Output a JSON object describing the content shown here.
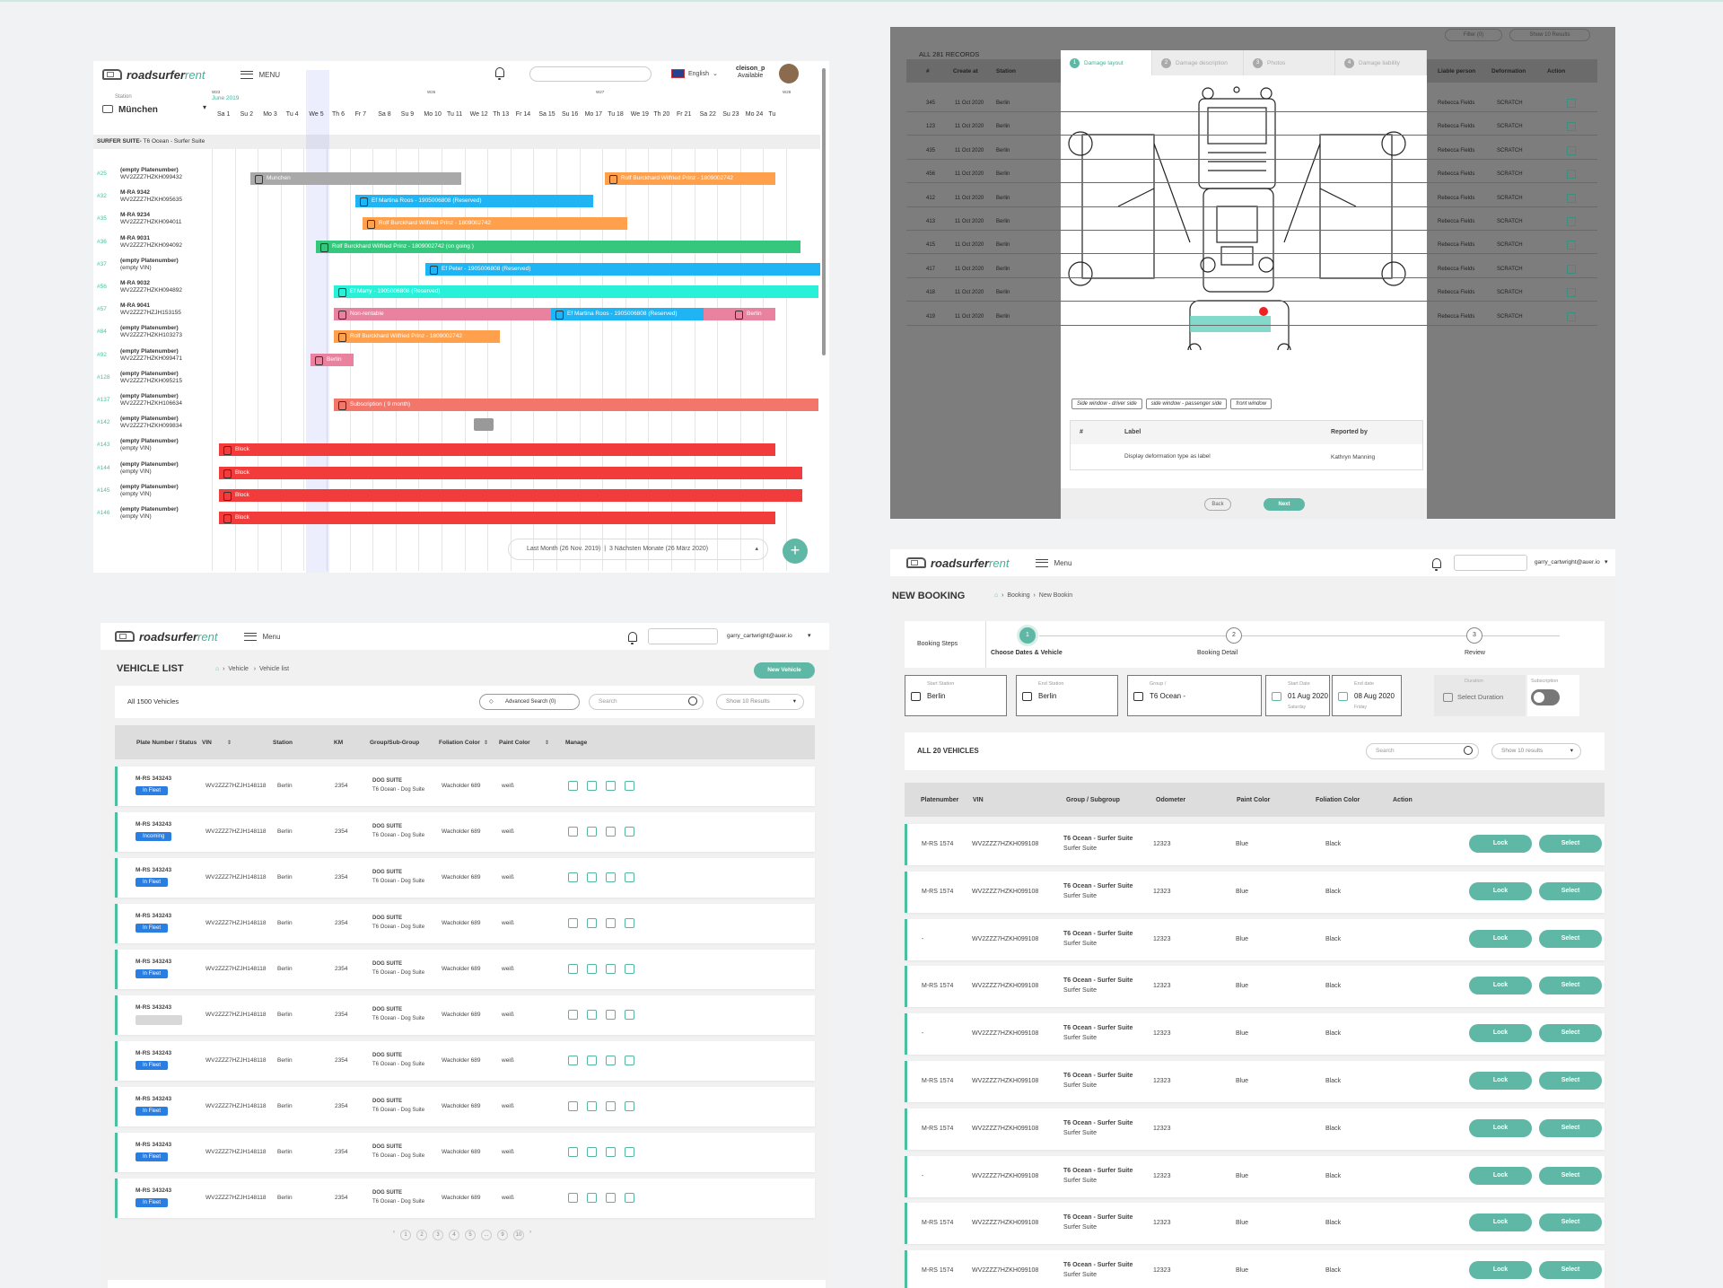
{
  "brand": {
    "name": "roadsurfer",
    "suffix": "rent"
  },
  "calendar": {
    "menu": "MENU",
    "language": "English",
    "user_name": "cleison_p",
    "user_status": "Available",
    "station_label": "Station",
    "station": "München",
    "month": "June 2019",
    "weeks": [
      "W23",
      "W26",
      "W27",
      "W28"
    ],
    "days": [
      "Sa 1",
      "Su 2",
      "Mo 3",
      "Tu 4",
      "We 5",
      "Th 6",
      "Fr 7",
      "Sa 8",
      "Su 9",
      "Mo 10",
      "Tu 11",
      "We 12",
      "Th 13",
      "Fr 14",
      "Sa 15",
      "Su 16",
      "Mo 17",
      "Tu 18",
      "We 19",
      "Th 20",
      "Fr 21",
      "Sa 22",
      "Su 23",
      "Mo 24",
      "Tu"
    ],
    "suite_title": "SURFER SUITE-",
    "suite_sub": "T6 Ocean - Surfer Suite",
    "vehicles": [
      {
        "num": "#25",
        "plate": "(empty Platenumber)",
        "vin": "WV2ZZZ7HZKH099432"
      },
      {
        "num": "#32",
        "plate": "M-RA 9342",
        "vin": "WV2ZZZ7HZKH095635"
      },
      {
        "num": "#35",
        "plate": "M-RA 9234",
        "vin": "WV2ZZZ7HZKH094011"
      },
      {
        "num": "#36",
        "plate": "M-RA 9031",
        "vin": "WV2ZZZ7HZKH094092"
      },
      {
        "num": "#37",
        "plate": "(empty Platenumber)",
        "vin": "(empty VIN)"
      },
      {
        "num": "#56",
        "plate": "M-RA 9032",
        "vin": "WV2ZZZ7HZKH094892"
      },
      {
        "num": "#57",
        "plate": "M-RA 9041",
        "vin": "WV2ZZZ7HZJH153155"
      },
      {
        "num": "#84",
        "plate": "(empty Platenumber)",
        "vin": "WV2ZZZ7HZKH103273"
      },
      {
        "num": "#92",
        "plate": "(empty Platenumber)",
        "vin": "WV2ZZZ7HZKH099471"
      },
      {
        "num": "#128",
        "plate": "(empty Platenumber)",
        "vin": "WV2ZZZ7HZKH095215"
      },
      {
        "num": "#137",
        "plate": "(empty Platenumber)",
        "vin": "WV2ZZZ7HZKH106634"
      },
      {
        "num": "#142",
        "plate": "(empty Platenumber)",
        "vin": "WV2ZZZ7HZKH099834"
      },
      {
        "num": "#143",
        "plate": "(empty Platenumber)",
        "vin": "(empty VIN)"
      },
      {
        "num": "#144",
        "plate": "(empty Platenumber)",
        "vin": "(empty VIN)"
      },
      {
        "num": "#145",
        "plate": "(empty Platenumber)",
        "vin": "(empty VIN)"
      },
      {
        "num": "#146",
        "plate": "(empty Platenumber)",
        "vin": "(empty VIN)"
      }
    ],
    "bookings": [
      "Munchen",
      "Rolf Burckhard Wilfried Prinz - 1809002742",
      "Ef Martina Roos - 1905006808 (Reserved)",
      "Rolf Burckhard Wilfried Prinz - 1809002742",
      "Rolf Burckhard Wilfried Prinz - 1809002742 (on going )",
      "Ef Peter - 1905006808 (Reserved)",
      "Ef Marry - 1905006808 (Reserved)",
      "Non-rentable",
      "Ef Martina Roos - 1905006808 (Reserved)",
      "Berlin",
      "Rolf Burckhard Wilfried Prinz - 1809002742",
      "Berlin",
      "Subscription ( 9 month)",
      "Block",
      "Block",
      "Block",
      "Block"
    ],
    "range_from": "Last Month (26 Nov. 2019)",
    "range_to": "3 Nächsten Monate (26 März 2020)",
    "colors": {
      "grey": "#a9a9a9",
      "orange": "#ffa04d",
      "blue": "#1fb5f5",
      "green": "#35c77d",
      "cyan": "#29f0d8",
      "pink": "#e9829e",
      "salmon": "#f3766a",
      "red": "#f23b3b"
    }
  },
  "damage": {
    "filter": "Filter (0)",
    "show": "Show 10 Results",
    "records": "ALL 281 RECORDS",
    "columns": [
      "#",
      "Create at",
      "Station",
      "Liable person",
      "Deformation",
      "Action"
    ],
    "rows": [
      {
        "n": "345",
        "d": "11 Oct 2020",
        "s": "Berlin",
        "p": "Rebecca Fields",
        "t": "SCRATCH"
      },
      {
        "n": "123",
        "d": "11 Oct 2020",
        "s": "Berlin",
        "p": "Rebecca Fields",
        "t": "SCRATCH"
      },
      {
        "n": "435",
        "d": "11 Oct 2020",
        "s": "Berlin",
        "p": "Rebecca Fields",
        "t": "SCRATCH"
      },
      {
        "n": "456",
        "d": "11 Oct 2020",
        "s": "Berlin",
        "p": "Rebecca Fields",
        "t": "SCRATCH"
      },
      {
        "n": "412",
        "d": "11 Oct 2020",
        "s": "Berlin",
        "p": "Rebecca Fields",
        "t": "SCRATCH"
      },
      {
        "n": "413",
        "d": "11 Oct 2020",
        "s": "Berlin",
        "p": "Rebecca Fields",
        "t": "SCRATCH"
      },
      {
        "n": "415",
        "d": "11 Oct 2020",
        "s": "Berlin",
        "p": "Rebecca Fields",
        "t": "SCRATCH"
      },
      {
        "n": "417",
        "d": "11 Oct 2020",
        "s": "Berlin",
        "p": "Rebecca Fields",
        "t": "SCRATCH"
      },
      {
        "n": "418",
        "d": "11 Oct 2020",
        "s": "Berlin",
        "p": "Rebecca Fields",
        "t": "SCRATCH"
      },
      {
        "n": "419",
        "d": "11 Oct 2020",
        "s": "Berlin",
        "p": "Rebecca Fields",
        "t": "SCRATCH"
      }
    ],
    "tabs": [
      "Damage layout",
      "Damage description",
      "Photos",
      "Damage liability"
    ],
    "chips": [
      "Side window - driver side",
      "side window - passenger side",
      "front window"
    ],
    "tbl_cols": [
      "#",
      "Label",
      "Reported by"
    ],
    "tbl_row": {
      "label": "Display deformation type as label",
      "by": "Kathryn Manning"
    },
    "back": "Back",
    "next": "Next"
  },
  "vlist": {
    "menu": "Menu",
    "user": "garry_cartwright@auer.io",
    "title": "VEHICLE LIST",
    "crumb1": "Vehicle",
    "crumb2": "Vehicle list",
    "new_btn": "New Vehicle",
    "count": "All 1500 Vehicles",
    "adv": "Advanced Search (0)",
    "search_ph": "Search",
    "show": "Show 10 Results",
    "columns": [
      "Plate Number / Status",
      "VIN",
      "Station",
      "KM",
      "Group/Sub-Group",
      "Foliation Color",
      "Paint Color",
      "Manage"
    ],
    "rows": [
      {
        "plate": "M-RS 343243",
        "status": "In Fleet",
        "vin": "WV2ZZZ7HZJH148118",
        "station": "Berlin",
        "km": "2354",
        "group": "DOG SUITE",
        "sub": "T6 Ocean - Dog Suite",
        "fol": "Wacholder 689",
        "paint": "weiß"
      },
      {
        "plate": "M-RS 343243",
        "status": "Incoming",
        "vin": "WV2ZZZ7HZJH148118",
        "station": "Berlin",
        "km": "2354",
        "group": "DOG SUITE",
        "sub": "T6 Ocean - Dog Suite",
        "fol": "Wacholder 689",
        "paint": "weiß"
      },
      {
        "plate": "M-RS 343243",
        "status": "In Fleet",
        "vin": "WV2ZZZ7HZJH148118",
        "station": "Berlin",
        "km": "2354",
        "group": "DOG SUITE",
        "sub": "T6 Ocean - Dog Suite",
        "fol": "Wacholder 689",
        "paint": "weiß"
      },
      {
        "plate": "M-RS 343243",
        "status": "In Fleet",
        "vin": "WV2ZZZ7HZJH148118",
        "station": "Berlin",
        "km": "2354",
        "group": "DOG SUITE",
        "sub": "T6 Ocean - Dog Suite",
        "fol": "Wacholder 689",
        "paint": "weiß"
      },
      {
        "plate": "M-RS 343243",
        "status": "In Fleet",
        "vin": "WV2ZZZ7HZJH148118",
        "station": "Berlin",
        "km": "2354",
        "group": "DOG SUITE",
        "sub": "T6 Ocean - Dog Suite",
        "fol": "Wacholder 689",
        "paint": "weiß"
      },
      {
        "plate": "M-RS 343243",
        "status": "",
        "vin": "WV2ZZZ7HZJH148118",
        "station": "Berlin",
        "km": "2354",
        "group": "DOG SUITE",
        "sub": "T6 Ocean - Dog Suite",
        "fol": "Wacholder 689",
        "paint": "weiß"
      },
      {
        "plate": "M-RS 343243",
        "status": "In Fleet",
        "vin": "WV2ZZZ7HZJH148118",
        "station": "Berlin",
        "km": "2354",
        "group": "DOG SUITE",
        "sub": "T6 Ocean - Dog Suite",
        "fol": "Wacholder 689",
        "paint": "weiß"
      },
      {
        "plate": "M-RS 343243",
        "status": "In Fleet",
        "vin": "WV2ZZZ7HZJH148118",
        "station": "Berlin",
        "km": "2354",
        "group": "DOG SUITE",
        "sub": "T6 Ocean - Dog Suite",
        "fol": "Wacholder 689",
        "paint": "weiß"
      },
      {
        "plate": "M-RS 343243",
        "status": "In Fleet",
        "vin": "WV2ZZZ7HZJH148118",
        "station": "Berlin",
        "km": "2354",
        "group": "DOG SUITE",
        "sub": "T6 Ocean - Dog Suite",
        "fol": "Wacholder 689",
        "paint": "weiß"
      },
      {
        "plate": "M-RS 343243",
        "status": "In Fleet",
        "vin": "WV2ZZZ7HZJH148118",
        "station": "Berlin",
        "km": "2354",
        "group": "DOG SUITE",
        "sub": "T6 Ocean - Dog Suite",
        "fol": "Wacholder 689",
        "paint": "weiß"
      }
    ],
    "pages": [
      "1",
      "2",
      "3",
      "4",
      "5",
      "...",
      "9",
      "10"
    ]
  },
  "booking": {
    "menu": "Menu",
    "user": "garry_cartwright@auer.io",
    "title": "NEW BOOKING",
    "crumb1": "Booking",
    "crumb2": "New Bookin",
    "steps_label": "Booking Steps",
    "steps": [
      {
        "n": "1",
        "label": "Choose Dates & Vehicle"
      },
      {
        "n": "2",
        "label": "Booking Detail"
      },
      {
        "n": "3",
        "label": "Review"
      }
    ],
    "start_station_label": "Start Station",
    "start_station": "Berlin",
    "end_station_label": "End Station",
    "end_station": "Berlin",
    "group_label": "Group /",
    "group": "T6 Ocean -",
    "start_date_label": "Start Date",
    "start_date": "01 Aug 2020",
    "start_day": "Saturday",
    "end_date_label": "End date",
    "end_date": "08 Aug 2020",
    "end_day": "Friday",
    "duration_label": "Duration",
    "duration": "Select Duration",
    "sub_label": "Subscription",
    "count": "ALL 20 VEHICLES",
    "search_ph": "Search",
    "show": "Show 10 results",
    "columns": [
      "Platenumber",
      "VIN",
      "Group / Subgroup",
      "Odometer",
      "Paint Color",
      "Foliation Color",
      "Action"
    ],
    "rows": [
      {
        "plate": "M-RS 1574",
        "vin": "WV2ZZZ7HZKH099108",
        "group": "T6 Ocean - Surfer Suite",
        "sub": "Surfer Suite",
        "odo": "12323",
        "paint": "Blue",
        "fol": "Black"
      },
      {
        "plate": "M-RS 1574",
        "vin": "WV2ZZZ7HZKH099108",
        "group": "T6 Ocean - Surfer Suite",
        "sub": "Surfer Suite",
        "odo": "12323",
        "paint": "Blue",
        "fol": "Black"
      },
      {
        "plate": "-",
        "vin": "WV2ZZZ7HZKH099108",
        "group": "T6 Ocean - Surfer Suite",
        "sub": "Surfer Suite",
        "odo": "12323",
        "paint": "Blue",
        "fol": "Black"
      },
      {
        "plate": "M-RS 1574",
        "vin": "WV2ZZZ7HZKH099108",
        "group": "T6 Ocean - Surfer Suite",
        "sub": "Surfer Suite",
        "odo": "12323",
        "paint": "Blue",
        "fol": "Black"
      },
      {
        "plate": "-",
        "vin": "WV2ZZZ7HZKH099108",
        "group": "T6 Ocean - Surfer Suite",
        "sub": "Surfer Suite",
        "odo": "12323",
        "paint": "Blue",
        "fol": "Black"
      },
      {
        "plate": "M-RS 1574",
        "vin": "WV2ZZZ7HZKH099108",
        "group": "T6 Ocean - Surfer Suite",
        "sub": "Surfer Suite",
        "odo": "12323",
        "paint": "Blue",
        "fol": "Black"
      },
      {
        "plate": "M-RS 1574",
        "vin": "WV2ZZZ7HZKH099108",
        "group": "T6 Ocean - Surfer Suite",
        "sub": "Surfer Suite",
        "odo": "12323",
        "paint": "",
        "fol": "Black"
      },
      {
        "plate": "-",
        "vin": "WV2ZZZ7HZKH099108",
        "group": "T6 Ocean - Surfer Suite",
        "sub": "Surfer Suite",
        "odo": "12323",
        "paint": "Blue",
        "fol": "Black"
      },
      {
        "plate": "M-RS 1574",
        "vin": "WV2ZZZ7HZKH099108",
        "group": "T6 Ocean - Surfer Suite",
        "sub": "Surfer Suite",
        "odo": "12323",
        "paint": "Blue",
        "fol": "Black"
      },
      {
        "plate": "M-RS 1574",
        "vin": "WV2ZZZ7HZKH099108",
        "group": "T6 Ocean - Surfer Suite",
        "sub": "Surfer Suite",
        "odo": "12323",
        "paint": "Blue",
        "fol": "Black"
      }
    ],
    "lock": "Lock",
    "select": "Select"
  }
}
